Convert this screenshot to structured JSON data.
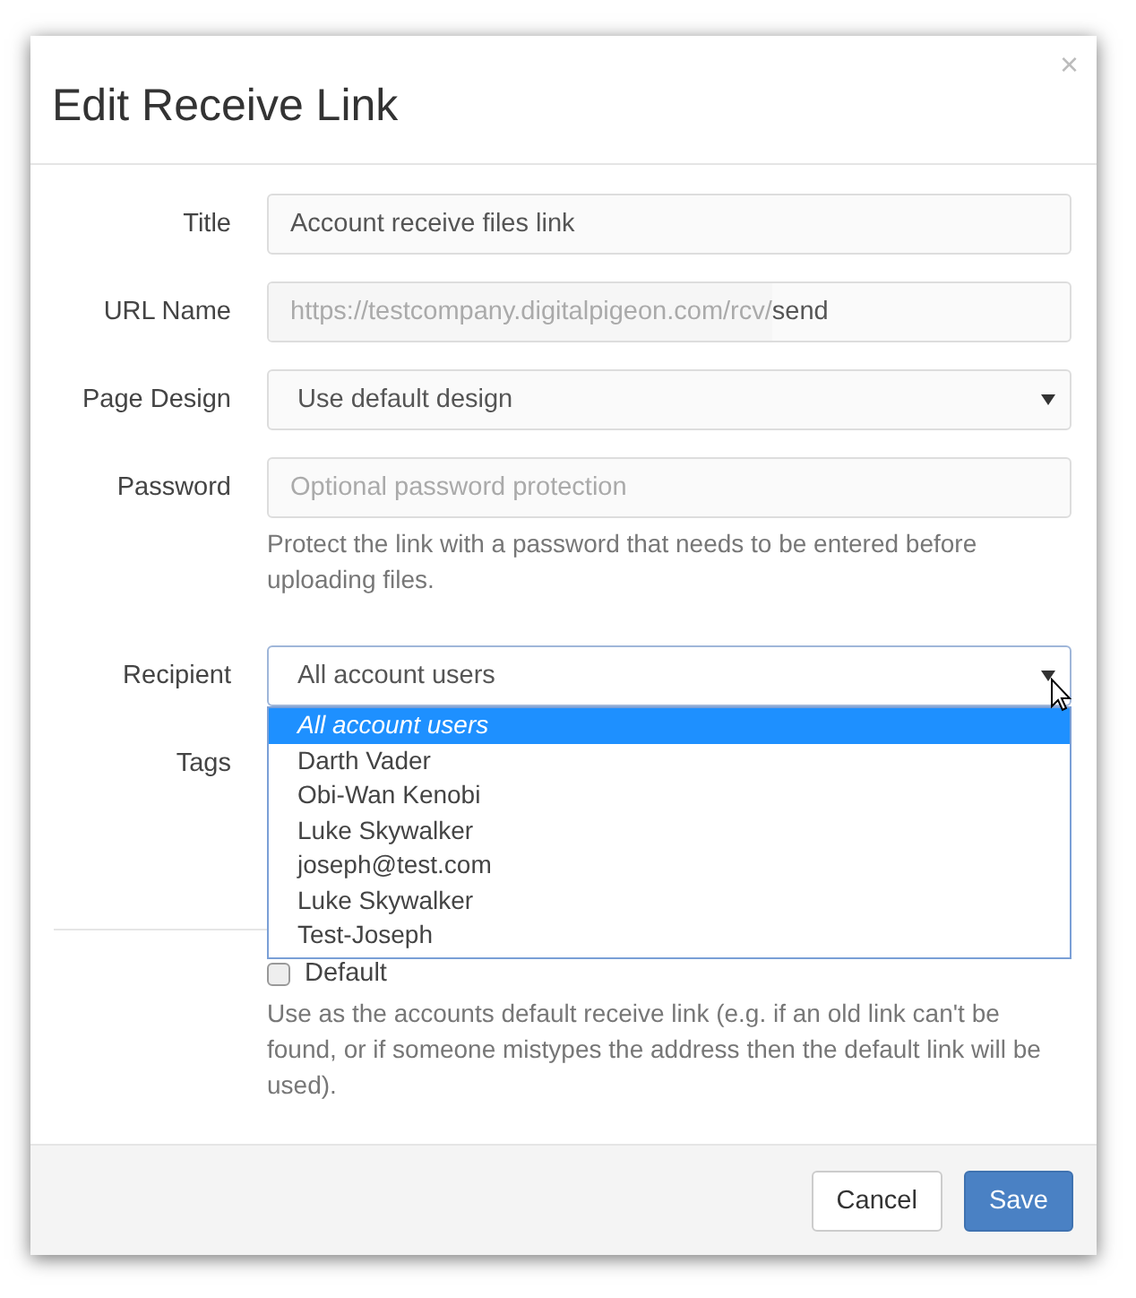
{
  "dialog": {
    "title": "Edit Receive Link",
    "close": "×"
  },
  "fields": [
    {
      "kind": "text",
      "label": "Title",
      "value": "Account receive files link"
    },
    {
      "kind": "url",
      "label": "URL Name",
      "prefix": "https://testcompany.digitalpigeon.com/rcv/",
      "value": "send"
    },
    {
      "kind": "select",
      "label": "Page Design",
      "value": "Use default design"
    },
    {
      "kind": "input",
      "label": "Password",
      "placeholder": "Optional password protection",
      "help": "Protect the link with a password that needs to be entered before uploading files."
    },
    {
      "kind": "open_select",
      "label": "Recipient",
      "value": "All account users",
      "options": [
        {
          "label": "All account users",
          "selected": true
        },
        {
          "label": "Darth Vader",
          "selected": false
        },
        {
          "label": "Obi-Wan Kenobi",
          "selected": false
        },
        {
          "label": "Luke Skywalker",
          "selected": false
        },
        {
          "label": "joseph@test.com",
          "selected": false
        },
        {
          "label": "Luke Skywalker",
          "selected": false
        },
        {
          "label": "Test-Joseph",
          "selected": false
        }
      ]
    },
    {
      "kind": "hidden",
      "label": "Tags"
    }
  ],
  "default_option": {
    "label": "Default",
    "checked": false,
    "help": "Use as the accounts default receive link (e.g. if an old link can't be found, or if someone mistypes the address then the default link will be used)."
  },
  "buttons": [
    {
      "label": "Cancel",
      "kind": "secondary"
    },
    {
      "label": "Save",
      "kind": "primary"
    }
  ]
}
